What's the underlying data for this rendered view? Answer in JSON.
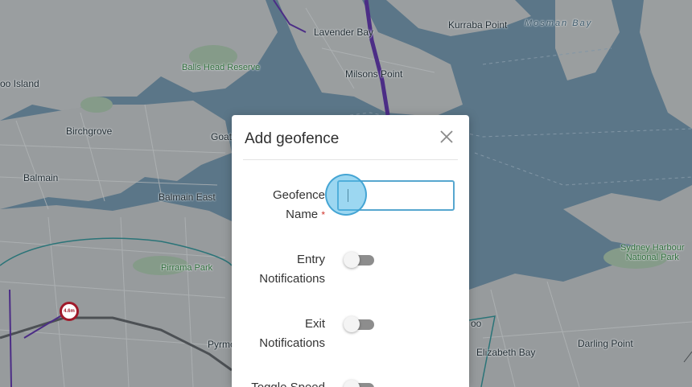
{
  "map": {
    "labels": {
      "lavender_bay": "Lavender Bay",
      "kurraba_point": "Kurraba Point",
      "mosman_bay": "Mosman Bay",
      "balls_head_reserve": "Balls Head Reserve",
      "milsons_point": "Milsons Point",
      "goat_island": "Goat",
      "island_left": "oo Island",
      "birchgrove": "Birchgrove",
      "balmain": "Balmain",
      "balmain_east": "Balmain East",
      "pirrama_park": "Pirrama Park",
      "pyrmont": "Pyrmo",
      "sydney_harbour_np_1": "Sydney Harbour",
      "sydney_harbour_np_2": "National Park",
      "elizabeth_bay": "Elizabeth Bay",
      "darling_point": "Darling Point",
      "rushcutters": "oo"
    },
    "badge_text": "4.6m"
  },
  "modal": {
    "title": "Add geofence",
    "close_icon": "close-icon",
    "fields": {
      "name_label_line1": "Geofence",
      "name_label_line2": "Name",
      "required_mark": "*",
      "name_value": "",
      "entry_label_line1": "Entry",
      "entry_label_line2": "Notifications",
      "entry_enabled": false,
      "exit_label_line1": "Exit",
      "exit_label_line2": "Notifications",
      "exit_enabled": false,
      "speed_label_line1": "Toggle Speed",
      "speed_enabled": false
    }
  }
}
